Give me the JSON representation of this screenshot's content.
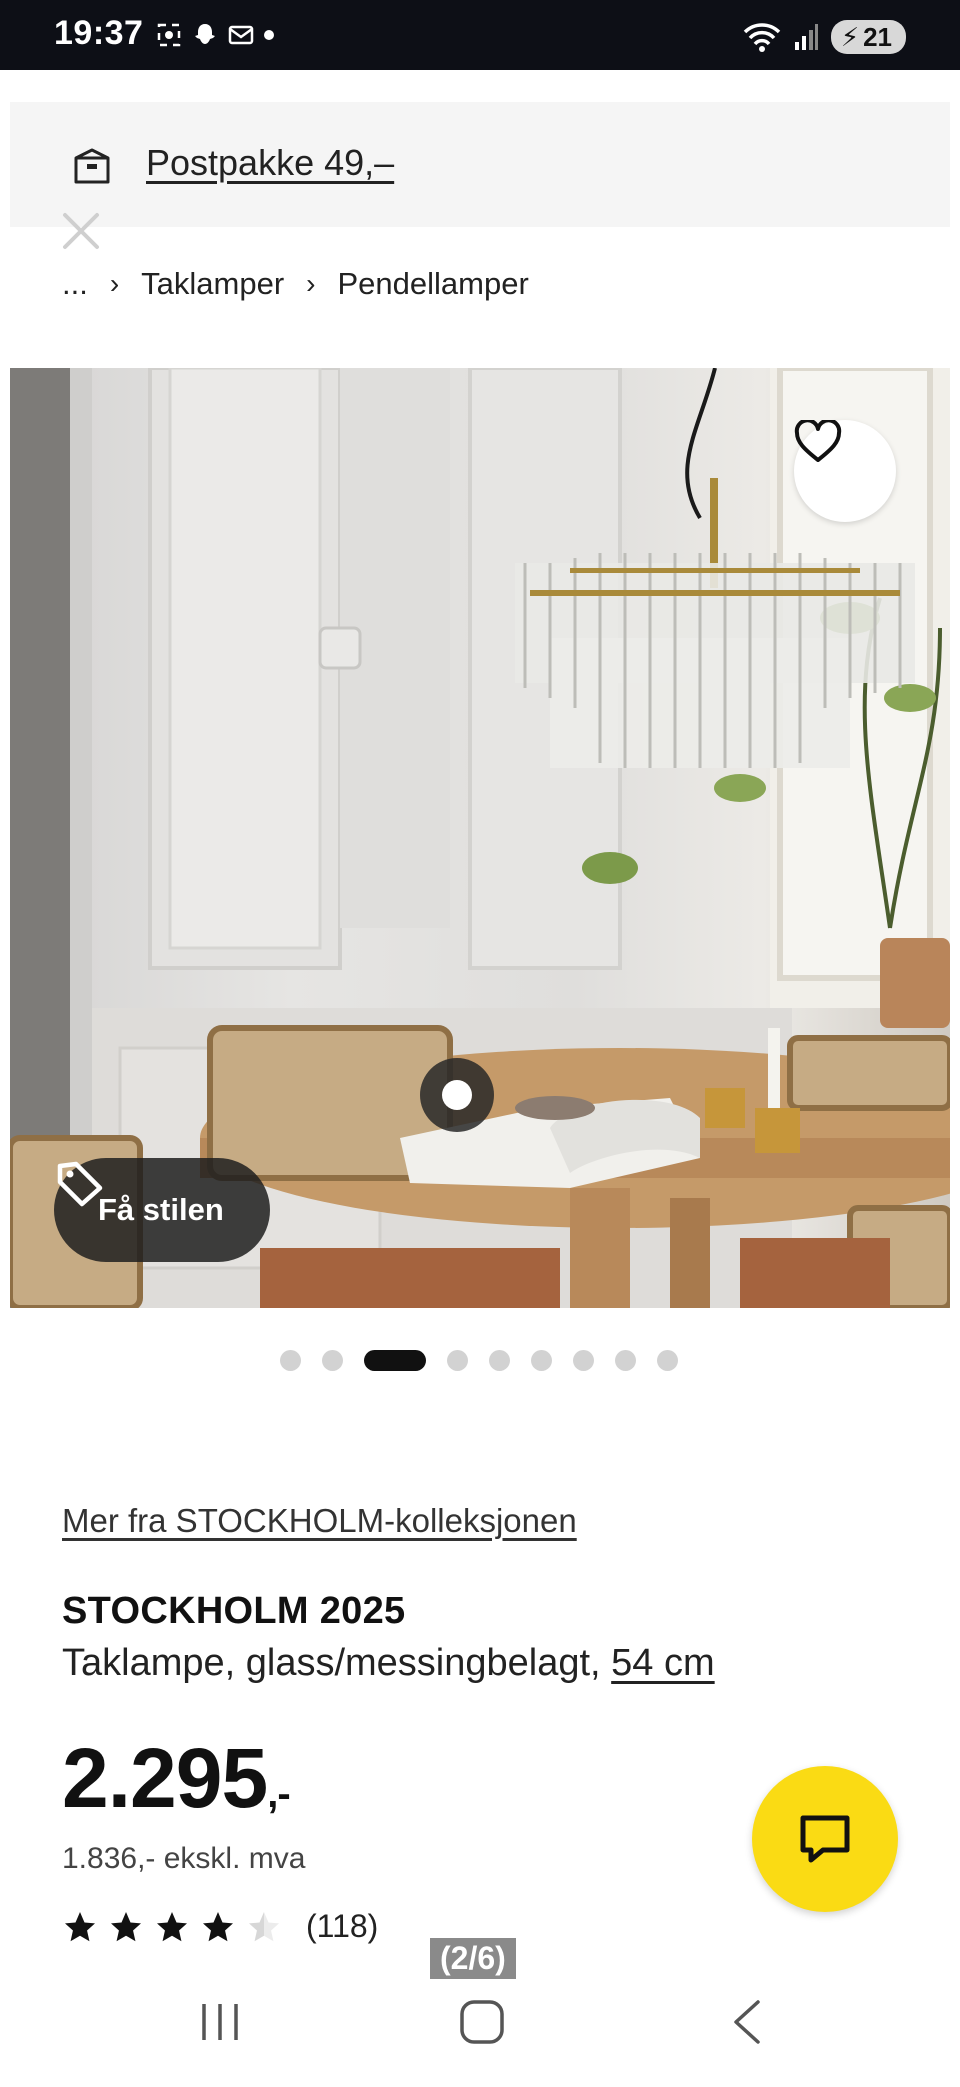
{
  "status_bar": {
    "time": "19:37",
    "battery": "21"
  },
  "shipping_banner": {
    "text": "Postpakke 49,–"
  },
  "breadcrumb": {
    "ellipsis": "...",
    "items": [
      "Taklamper",
      "Pendellamper"
    ]
  },
  "hero": {
    "style_button_label": "Få stilen",
    "dots_total": 9,
    "active_dot": 3
  },
  "product": {
    "collection_link": "Mer fra STOCKHOLM-kolleksjonen",
    "name": "STOCKHOLM 2025",
    "description": "Taklampe, glass/messingbelagt, ",
    "size_link": "54 cm",
    "price_main": "2.295",
    "price_suffix": ",-",
    "price_ex_vat": "1.836,- ekskl. mva",
    "rating_value": 4.5,
    "rating_max": 5,
    "review_count": "(118)"
  },
  "page_indicator": "(2/6)",
  "colors": {
    "accent_yellow": "#fadb14",
    "status_bar_bg": "#0d0f16"
  }
}
